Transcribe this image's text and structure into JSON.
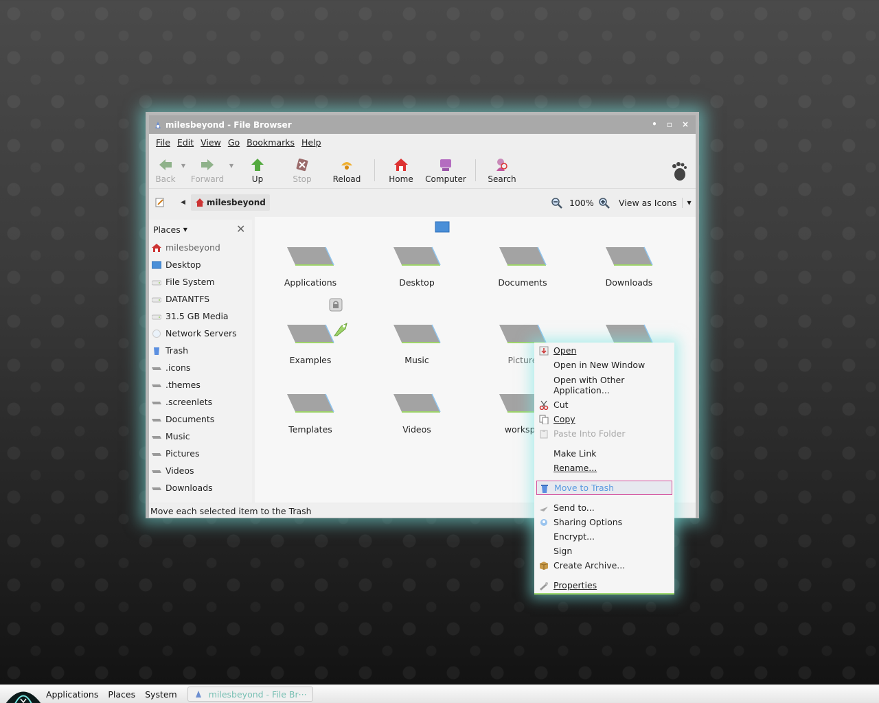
{
  "window": {
    "title": "milesbeyond - File Browser",
    "controls": {
      "minimize": "•",
      "maximize": "▫",
      "close": "×"
    }
  },
  "menubar": {
    "items": [
      {
        "label": "File"
      },
      {
        "label": "Edit"
      },
      {
        "label": "View"
      },
      {
        "label": "Go"
      },
      {
        "label": "Bookmarks"
      },
      {
        "label": "Help"
      }
    ]
  },
  "toolbar": {
    "back": "Back",
    "forward": "Forward",
    "up": "Up",
    "stop": "Stop",
    "reload": "Reload",
    "home": "Home",
    "computer": "Computer",
    "search": "Search"
  },
  "location": {
    "current": "milesbeyond",
    "zoom": "100%",
    "view_mode": "View as Icons"
  },
  "sidebar": {
    "header": "Places",
    "items": [
      {
        "label": "milesbeyond",
        "icon": "home-icon"
      },
      {
        "label": "Desktop",
        "icon": "desktop-icon"
      },
      {
        "label": "File System",
        "icon": "drive-icon"
      },
      {
        "label": "DATANTFS",
        "icon": "drive-icon"
      },
      {
        "label": "31.5 GB Media",
        "icon": "drive-icon"
      },
      {
        "label": "Network Servers",
        "icon": "network-icon"
      },
      {
        "label": "Trash",
        "icon": "trash-icon"
      },
      {
        "label": ".icons",
        "icon": "folder-icon"
      },
      {
        "label": ".themes",
        "icon": "folder-icon"
      },
      {
        "label": ".screenlets",
        "icon": "folder-icon"
      },
      {
        "label": "Documents",
        "icon": "folder-icon"
      },
      {
        "label": "Music",
        "icon": "folder-icon"
      },
      {
        "label": "Pictures",
        "icon": "folder-icon"
      },
      {
        "label": "Videos",
        "icon": "folder-icon"
      },
      {
        "label": "Downloads",
        "icon": "folder-icon"
      }
    ]
  },
  "files": [
    {
      "name": "Applications"
    },
    {
      "name": "Desktop"
    },
    {
      "name": "Documents"
    },
    {
      "name": "Downloads"
    },
    {
      "name": "Examples"
    },
    {
      "name": "Music"
    },
    {
      "name": "Picture"
    },
    {
      "name": ""
    },
    {
      "name": "Templates"
    },
    {
      "name": "Videos"
    },
    {
      "name": "workspa"
    }
  ],
  "status": "Move each selected item to the Trash",
  "context_menu": {
    "open": "Open",
    "open_new_window": "Open in New Window",
    "open_with": "Open with Other Application...",
    "cut": "Cut",
    "copy": "Copy",
    "paste_into": "Paste Into Folder",
    "make_link": "Make Link",
    "rename": "Rename...",
    "move_to_trash": "Move to Trash",
    "send_to": "Send to...",
    "sharing": "Sharing Options",
    "encrypt": "Encrypt...",
    "sign": "Sign",
    "create_archive": "Create Archive...",
    "properties": "Properties"
  },
  "panel": {
    "applications": "Applications",
    "places": "Places",
    "system": "System",
    "task": "milesbeyond - File Br···"
  },
  "colors": {
    "glow": "#78e6e1",
    "highlight_border": "#d4509d",
    "highlight_text": "#5b9be0"
  }
}
